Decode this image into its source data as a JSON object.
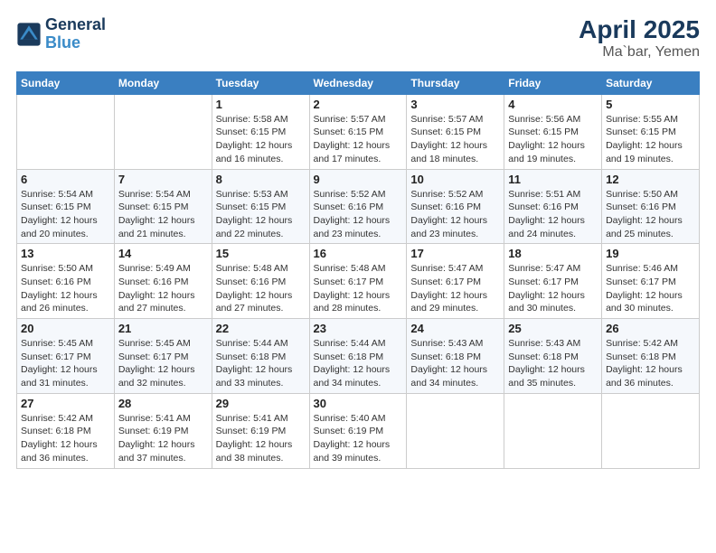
{
  "header": {
    "logo_general": "General",
    "logo_blue": "Blue",
    "title": "April 2025",
    "subtitle": "Ma`bar, Yemen"
  },
  "days_of_week": [
    "Sunday",
    "Monday",
    "Tuesday",
    "Wednesday",
    "Thursday",
    "Friday",
    "Saturday"
  ],
  "weeks": [
    [
      {
        "day": "",
        "info": ""
      },
      {
        "day": "",
        "info": ""
      },
      {
        "day": "1",
        "info": "Sunrise: 5:58 AM\nSunset: 6:15 PM\nDaylight: 12 hours and 16 minutes."
      },
      {
        "day": "2",
        "info": "Sunrise: 5:57 AM\nSunset: 6:15 PM\nDaylight: 12 hours and 17 minutes."
      },
      {
        "day": "3",
        "info": "Sunrise: 5:57 AM\nSunset: 6:15 PM\nDaylight: 12 hours and 18 minutes."
      },
      {
        "day": "4",
        "info": "Sunrise: 5:56 AM\nSunset: 6:15 PM\nDaylight: 12 hours and 19 minutes."
      },
      {
        "day": "5",
        "info": "Sunrise: 5:55 AM\nSunset: 6:15 PM\nDaylight: 12 hours and 19 minutes."
      }
    ],
    [
      {
        "day": "6",
        "info": "Sunrise: 5:54 AM\nSunset: 6:15 PM\nDaylight: 12 hours and 20 minutes."
      },
      {
        "day": "7",
        "info": "Sunrise: 5:54 AM\nSunset: 6:15 PM\nDaylight: 12 hours and 21 minutes."
      },
      {
        "day": "8",
        "info": "Sunrise: 5:53 AM\nSunset: 6:15 PM\nDaylight: 12 hours and 22 minutes."
      },
      {
        "day": "9",
        "info": "Sunrise: 5:52 AM\nSunset: 6:16 PM\nDaylight: 12 hours and 23 minutes."
      },
      {
        "day": "10",
        "info": "Sunrise: 5:52 AM\nSunset: 6:16 PM\nDaylight: 12 hours and 23 minutes."
      },
      {
        "day": "11",
        "info": "Sunrise: 5:51 AM\nSunset: 6:16 PM\nDaylight: 12 hours and 24 minutes."
      },
      {
        "day": "12",
        "info": "Sunrise: 5:50 AM\nSunset: 6:16 PM\nDaylight: 12 hours and 25 minutes."
      }
    ],
    [
      {
        "day": "13",
        "info": "Sunrise: 5:50 AM\nSunset: 6:16 PM\nDaylight: 12 hours and 26 minutes."
      },
      {
        "day": "14",
        "info": "Sunrise: 5:49 AM\nSunset: 6:16 PM\nDaylight: 12 hours and 27 minutes."
      },
      {
        "day": "15",
        "info": "Sunrise: 5:48 AM\nSunset: 6:16 PM\nDaylight: 12 hours and 27 minutes."
      },
      {
        "day": "16",
        "info": "Sunrise: 5:48 AM\nSunset: 6:17 PM\nDaylight: 12 hours and 28 minutes."
      },
      {
        "day": "17",
        "info": "Sunrise: 5:47 AM\nSunset: 6:17 PM\nDaylight: 12 hours and 29 minutes."
      },
      {
        "day": "18",
        "info": "Sunrise: 5:47 AM\nSunset: 6:17 PM\nDaylight: 12 hours and 30 minutes."
      },
      {
        "day": "19",
        "info": "Sunrise: 5:46 AM\nSunset: 6:17 PM\nDaylight: 12 hours and 30 minutes."
      }
    ],
    [
      {
        "day": "20",
        "info": "Sunrise: 5:45 AM\nSunset: 6:17 PM\nDaylight: 12 hours and 31 minutes."
      },
      {
        "day": "21",
        "info": "Sunrise: 5:45 AM\nSunset: 6:17 PM\nDaylight: 12 hours and 32 minutes."
      },
      {
        "day": "22",
        "info": "Sunrise: 5:44 AM\nSunset: 6:18 PM\nDaylight: 12 hours and 33 minutes."
      },
      {
        "day": "23",
        "info": "Sunrise: 5:44 AM\nSunset: 6:18 PM\nDaylight: 12 hours and 34 minutes."
      },
      {
        "day": "24",
        "info": "Sunrise: 5:43 AM\nSunset: 6:18 PM\nDaylight: 12 hours and 34 minutes."
      },
      {
        "day": "25",
        "info": "Sunrise: 5:43 AM\nSunset: 6:18 PM\nDaylight: 12 hours and 35 minutes."
      },
      {
        "day": "26",
        "info": "Sunrise: 5:42 AM\nSunset: 6:18 PM\nDaylight: 12 hours and 36 minutes."
      }
    ],
    [
      {
        "day": "27",
        "info": "Sunrise: 5:42 AM\nSunset: 6:18 PM\nDaylight: 12 hours and 36 minutes."
      },
      {
        "day": "28",
        "info": "Sunrise: 5:41 AM\nSunset: 6:19 PM\nDaylight: 12 hours and 37 minutes."
      },
      {
        "day": "29",
        "info": "Sunrise: 5:41 AM\nSunset: 6:19 PM\nDaylight: 12 hours and 38 minutes."
      },
      {
        "day": "30",
        "info": "Sunrise: 5:40 AM\nSunset: 6:19 PM\nDaylight: 12 hours and 39 minutes."
      },
      {
        "day": "",
        "info": ""
      },
      {
        "day": "",
        "info": ""
      },
      {
        "day": "",
        "info": ""
      }
    ]
  ]
}
